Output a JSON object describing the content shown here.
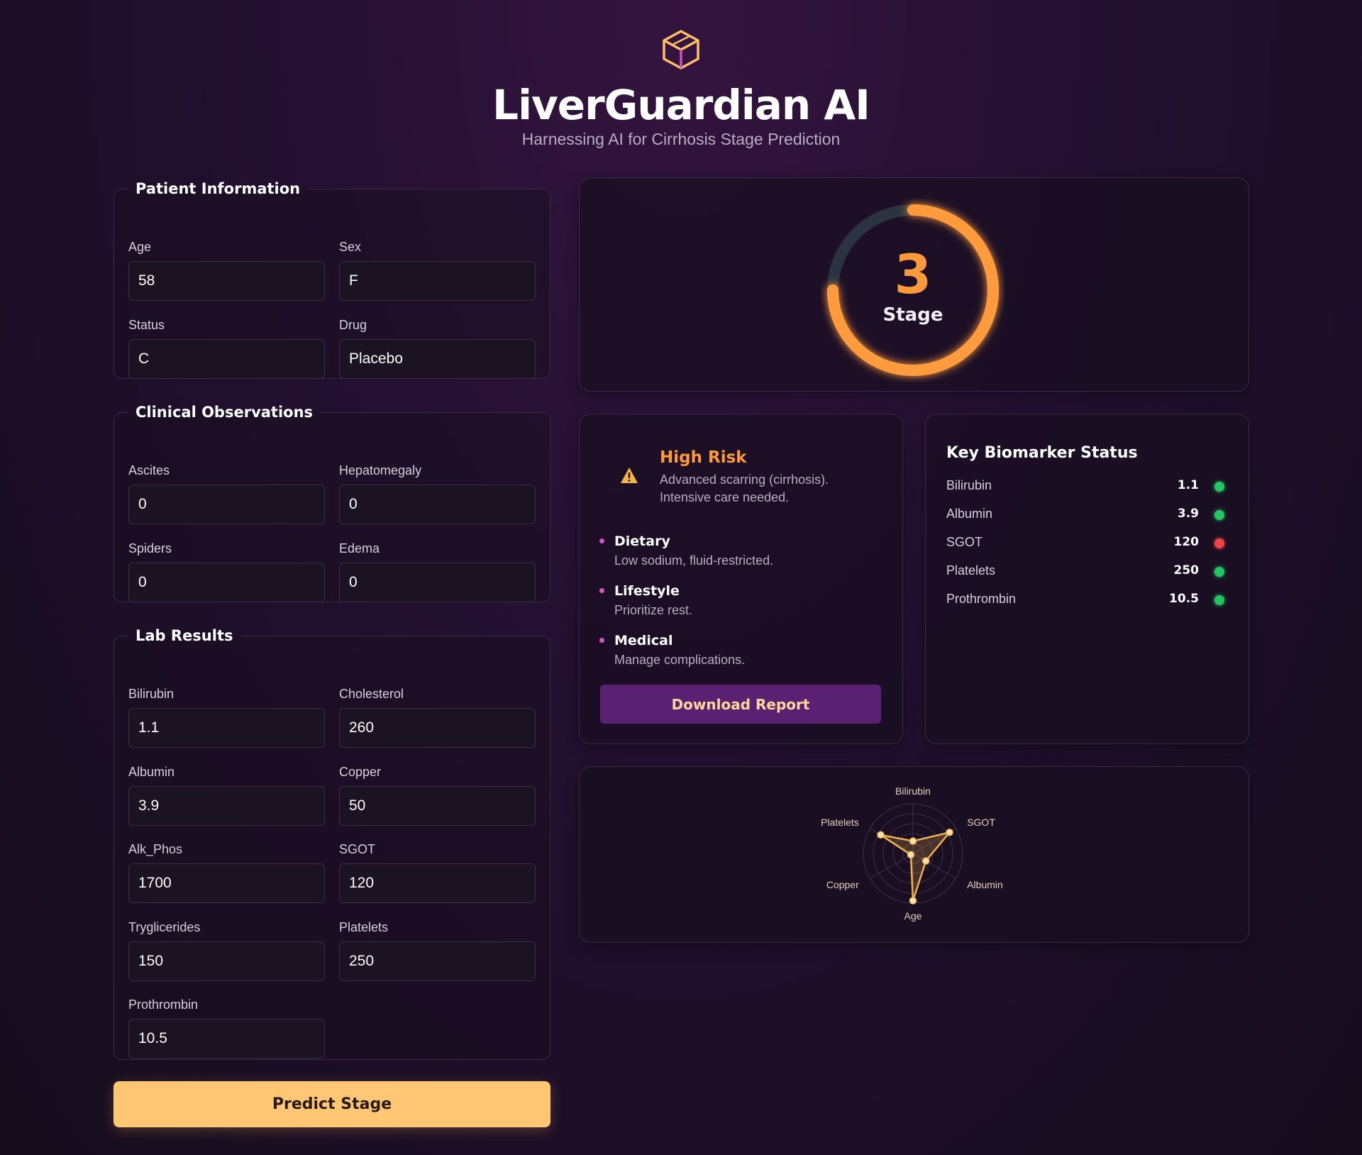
{
  "app": {
    "title": "LiverGuardian AI",
    "subtitle": "Harnessing AI for Cirrhosis Stage Prediction",
    "logo_icon": "cube-icon"
  },
  "patient_info": {
    "legend": "Patient Information",
    "fields": [
      {
        "label": "Age",
        "value": "58"
      },
      {
        "label": "Sex",
        "value": "F"
      },
      {
        "label": "Status",
        "value": "C"
      },
      {
        "label": "Drug",
        "value": "Placebo"
      }
    ]
  },
  "clinical": {
    "legend": "Clinical Observations",
    "fields": [
      {
        "label": "Ascites",
        "value": "0"
      },
      {
        "label": "Hepatomegaly",
        "value": "0"
      },
      {
        "label": "Spiders",
        "value": "0"
      },
      {
        "label": "Edema",
        "value": "0"
      }
    ]
  },
  "lab": {
    "legend": "Lab Results",
    "fields": [
      {
        "label": "Bilirubin",
        "value": "1.1"
      },
      {
        "label": "Cholesterol",
        "value": "260"
      },
      {
        "label": "Albumin",
        "value": "3.9"
      },
      {
        "label": "Copper",
        "value": "50"
      },
      {
        "label": "Alk_Phos",
        "value": "1700"
      },
      {
        "label": "SGOT",
        "value": "120"
      },
      {
        "label": "Tryglicerides",
        "value": "150"
      },
      {
        "label": "Platelets",
        "value": "250"
      },
      {
        "label": "Prothrombin",
        "value": "10.5"
      }
    ]
  },
  "predict_button": "Predict Stage",
  "stage": {
    "value": "3",
    "label": "Stage",
    "progress_fraction": 0.75,
    "color": "#ff9a3c",
    "track_color": "#2c3340"
  },
  "risk": {
    "title": "High Risk",
    "description": "Advanced scarring (cirrhosis). Intensive care needed.",
    "warning_icon": "warning-triangle-icon",
    "recommendations": [
      {
        "heading": "Dietary",
        "detail": "Low sodium, fluid-restricted."
      },
      {
        "heading": "Lifestyle",
        "detail": "Prioritize rest."
      },
      {
        "heading": "Medical",
        "detail": "Manage complications."
      }
    ],
    "download_button": "Download Report"
  },
  "biomarkers": {
    "title": "Key Biomarker Status",
    "items": [
      {
        "name": "Bilirubin",
        "value": "1.1",
        "status": "normal",
        "status_color": "#22c55e"
      },
      {
        "name": "Albumin",
        "value": "3.9",
        "status": "normal",
        "status_color": "#22c55e"
      },
      {
        "name": "SGOT",
        "value": "120",
        "status": "abnormal",
        "status_color": "#ef4444"
      },
      {
        "name": "Platelets",
        "value": "250",
        "status": "normal",
        "status_color": "#22c55e"
      },
      {
        "name": "Prothrombin",
        "value": "10.5",
        "status": "normal",
        "status_color": "#22c55e"
      }
    ]
  },
  "chart_data": {
    "type": "radar",
    "axes": [
      "Bilirubin",
      "SGOT",
      "Albumin",
      "Age",
      "Copper",
      "Platelets"
    ],
    "values": [
      0.25,
      0.85,
      0.3,
      0.95,
      0.05,
      0.75
    ],
    "range": [
      0,
      1
    ],
    "rings": 5,
    "color": "#f0b24d"
  }
}
